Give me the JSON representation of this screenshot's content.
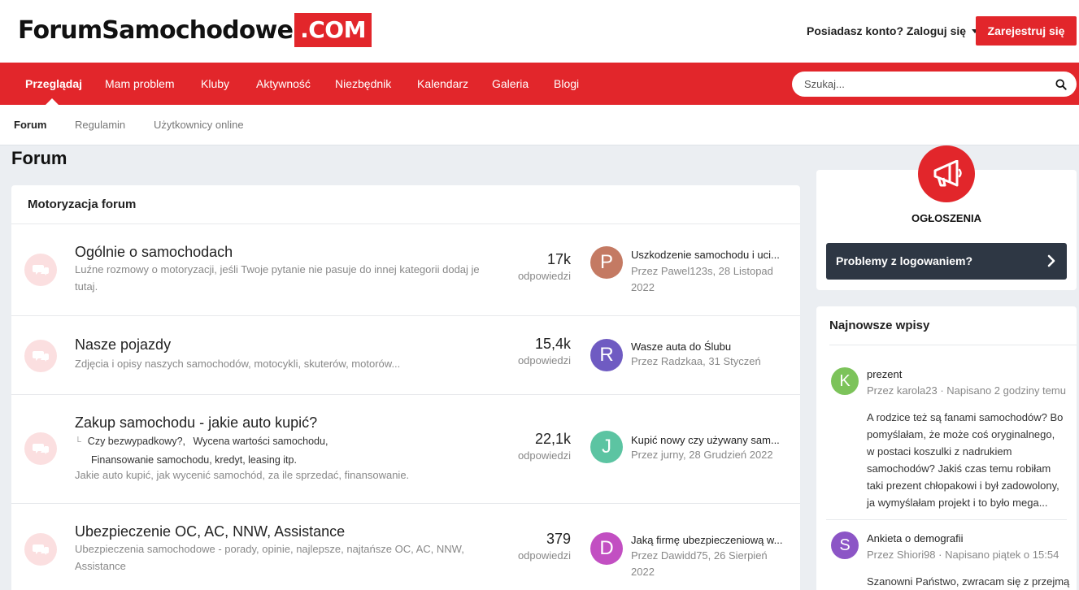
{
  "header": {
    "logo_main": "ForumSamochodowe",
    "logo_suffix": ".COM",
    "login_label": "Posiadasz konto? Zaloguj się",
    "register_label": "Zarejestruj się"
  },
  "nav": {
    "items": [
      "Przeglądaj",
      "Mam problem",
      "Kluby",
      "Aktywność",
      "Niezbędnik",
      "Kalendarz",
      "Galeria",
      "Blogi"
    ],
    "search_placeholder": "Szukaj..."
  },
  "subnav": {
    "items": [
      "Forum",
      "Regulamin",
      "Użytkownicy online"
    ]
  },
  "page_title": "Forum",
  "forum": {
    "section_title": "Motoryzacja forum",
    "rows": [
      {
        "name": "Ogólnie o samochodach",
        "description": "Luźne rozmowy o motoryzacji, jeśli Twoje pytanie nie pasuje do innej kategorii dodaj je tutaj.",
        "count": "17k",
        "count_label": "odpowiedzi",
        "avatar_letter": "P",
        "avatar_color": "#c47a63",
        "last_title": "Uszkodzenie samochodu i uci...",
        "last_meta": "Przez Pawel123s, 28 Listopad 2022"
      },
      {
        "name": "Nasze pojazdy",
        "description": "Zdjęcia i opisy naszych samochodów, motocykli, skuterów, motorów...",
        "count": "15,4k",
        "count_label": "odpowiedzi",
        "avatar_letter": "R",
        "avatar_color": "#6f5bc2",
        "last_title": "Wasze auta do Ślubu",
        "last_meta": "Przez Radzkaa, 31 Styczeń"
      },
      {
        "name": "Zakup samochodu - jakie auto kupić?",
        "subforums": [
          "Czy bezwypadkowy?,",
          "Wycena wartości samochodu,",
          "Finansowanie samochodu, kredyt, leasing itp."
        ],
        "description": "Jakie auto kupić, jak wycenić samochód, za ile sprzedać, finansowanie.",
        "count": "22,1k",
        "count_label": "odpowiedzi",
        "avatar_letter": "J",
        "avatar_color": "#5cc4a2",
        "last_title": "Kupić nowy czy używany sam...",
        "last_meta": "Przez jurny, 28 Grudzień 2022"
      },
      {
        "name": "Ubezpieczenie OC, AC, NNW, Assistance",
        "description": "Ubezpieczenia samochodowe - porady, opinie, najlepsze, najtańsze OC, AC, NNW, Assistance",
        "count": "379",
        "count_label": "odpowiedzi",
        "avatar_letter": "D",
        "avatar_color": "#c24fc2",
        "last_title": "Jaką firmę ubezpieczeniową w...",
        "last_meta": "Przez Dawidd75, 26 Sierpień 2022"
      }
    ]
  },
  "announcements": {
    "title": "OGŁOSZENIA",
    "item": "Problemy z logowaniem?"
  },
  "latest": {
    "title": "Najnowsze wpisy",
    "entries": [
      {
        "avatar_letter": "K",
        "avatar_color": "#7cc35a",
        "title": "prezent",
        "meta": "Przez karola23 · Napisano 2 godziny temu",
        "body": "A rodzice też są fanami samochodów? Bo pomyślałam, że może coś oryginalnego, w postaci koszulki z nadrukiem samochodów? Jakiś czas temu robiłam taki prezent chłopakowi i był zadowolony, ja wymyślałam projekt i to było mega..."
      },
      {
        "avatar_letter": "S",
        "avatar_color": "#8c55c6",
        "title": "Ankieta o demografii",
        "meta": "Przez Shiori98 · Napisano piątek o 15:54",
        "body": "Szanowni Państwo, zwracam się z przejmą"
      }
    ]
  },
  "colors": {
    "brand_red": "#e2262b",
    "dark_button": "#2e3744",
    "forum_icon_bg": "#fbdfe0"
  }
}
